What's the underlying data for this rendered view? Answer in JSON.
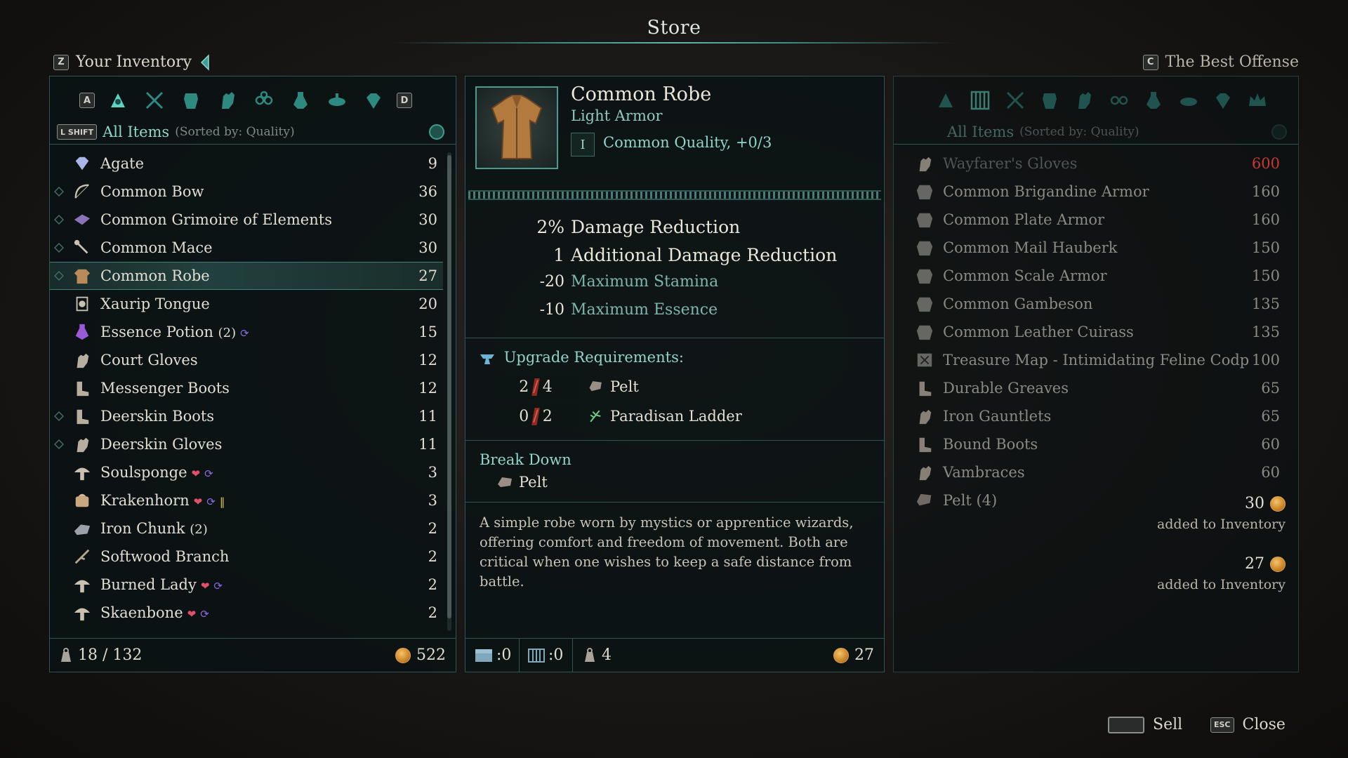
{
  "screen": {
    "title": "Store"
  },
  "left_header": {
    "key": "Z",
    "label": "Your Inventory"
  },
  "right_header": {
    "key": "C",
    "label": "The Best Offense"
  },
  "left_panel": {
    "tab_keys": {
      "prev": "A",
      "next": "D"
    },
    "tabs": [
      "all-items-icon",
      "weapons-icon",
      "armor-icon",
      "gloves-icon",
      "trinkets-icon",
      "potions-icon",
      "food-icon",
      "gems-icon"
    ],
    "filter_key": "L SHIFT",
    "filter_title": "All Items",
    "filter_sort": "(Sorted by: Quality)",
    "items": [
      {
        "name": "Agate",
        "value": "9",
        "icon": "gem-icon",
        "diamond": false
      },
      {
        "name": "Common Bow",
        "value": "36",
        "icon": "bow-icon",
        "diamond": true
      },
      {
        "name": "Common Grimoire of Elements",
        "value": "30",
        "icon": "grimoire-icon",
        "diamond": true
      },
      {
        "name": "Common Mace",
        "value": "30",
        "icon": "mace-icon",
        "diamond": true
      },
      {
        "name": "Common Robe",
        "value": "27",
        "icon": "robe-icon",
        "diamond": true,
        "selected": true
      },
      {
        "name": "Xaurip Tongue",
        "value": "20",
        "icon": "tongue-icon",
        "diamond": false
      },
      {
        "name": "Essence Potion",
        "count": "(2)",
        "value": "15",
        "icon": "potion-icon",
        "diamond": false,
        "badges": [
          "essence"
        ]
      },
      {
        "name": "Court Gloves",
        "value": "12",
        "icon": "gloves-icon",
        "diamond": false
      },
      {
        "name": "Messenger Boots",
        "value": "12",
        "icon": "boots-icon",
        "diamond": false
      },
      {
        "name": "Deerskin Boots",
        "value": "11",
        "icon": "boots-icon",
        "diamond": true
      },
      {
        "name": "Deerskin Gloves",
        "value": "11",
        "icon": "gloves-icon",
        "diamond": true
      },
      {
        "name": "Soulsponge",
        "value": "3",
        "icon": "mushroom-icon",
        "diamond": false,
        "badges": [
          "heart",
          "essence"
        ]
      },
      {
        "name": "Krakenhorn",
        "value": "3",
        "icon": "krakenhorn-icon",
        "diamond": false,
        "badges": [
          "heart",
          "essence",
          "stamina"
        ]
      },
      {
        "name": "Iron Chunk",
        "count": "(2)",
        "value": "2",
        "icon": "ore-icon",
        "diamond": false
      },
      {
        "name": "Softwood Branch",
        "value": "2",
        "icon": "branch-icon",
        "diamond": false
      },
      {
        "name": "Burned Lady",
        "value": "2",
        "icon": "mushroom-icon",
        "diamond": false,
        "badges": [
          "heart",
          "essence"
        ]
      },
      {
        "name": "Skaenbone",
        "value": "2",
        "icon": "mushroom-icon",
        "diamond": false,
        "badges": [
          "heart",
          "essence"
        ]
      }
    ],
    "footer": {
      "weight": "18 / 132",
      "gold": "522"
    }
  },
  "detail": {
    "name": "Common Robe",
    "type": "Light Armor",
    "quality_tier": "I",
    "quality": "Common Quality, +0/3",
    "stats": [
      {
        "num": "2%",
        "label": "Damage Reduction",
        "dim": false
      },
      {
        "num": "1",
        "label": "Additional Damage Reduction",
        "dim": false
      },
      {
        "num": "-20",
        "label": "Maximum Stamina",
        "dim": true
      },
      {
        "num": "-10",
        "label": "Maximum Essence",
        "dim": true
      }
    ],
    "upgrade_title": "Upgrade Requirements:",
    "requirements": [
      {
        "have": "2",
        "slash": "/",
        "need": "4",
        "name": "Pelt",
        "icon": "pelt-icon"
      },
      {
        "have": "0",
        "slash": "/",
        "need": "2",
        "name": "Paradisan Ladder",
        "icon": "herb-icon"
      }
    ],
    "breakdown_title": "Break Down",
    "breakdown_item": "Pelt",
    "description": "A simple robe worn by mystics or apprentice wizards, offering comfort and freedom of movement. Both are critical when one wishes to keep a safe distance from battle.",
    "footer": {
      "stash_a": ":0",
      "stash_b": ":0",
      "weight": "4",
      "price": "27"
    }
  },
  "right_panel": {
    "filter_title": "All Items",
    "filter_sort": "(Sorted by: Quality)",
    "items": [
      {
        "name": "Wayfarer's Gloves",
        "value": "600",
        "faded": true,
        "red": true,
        "icon": "gloves-icon"
      },
      {
        "name": "Common Brigandine Armor",
        "value": "160",
        "icon": "armor-icon"
      },
      {
        "name": "Common Plate Armor",
        "value": "160",
        "icon": "armor-icon"
      },
      {
        "name": "Common Mail Hauberk",
        "value": "150",
        "icon": "armor-icon"
      },
      {
        "name": "Common Scale Armor",
        "value": "150",
        "icon": "armor-icon"
      },
      {
        "name": "Common Gambeson",
        "value": "135",
        "icon": "armor-icon"
      },
      {
        "name": "Common Leather Cuirass",
        "value": "135",
        "icon": "armor-icon"
      },
      {
        "name": "Treasure Map - Intimidating Feline Codp",
        "value": "100",
        "icon": "map-icon"
      },
      {
        "name": "Durable Greaves",
        "value": "65",
        "icon": "boots-icon"
      },
      {
        "name": "Iron Gauntlets",
        "value": "65",
        "icon": "gloves-icon"
      },
      {
        "name": "Bound Boots",
        "value": "60",
        "icon": "boots-icon"
      },
      {
        "name": "Vambraces",
        "value": "60",
        "icon": "gloves-icon"
      },
      {
        "name": "Pelt (4)",
        "value": "",
        "icon": "pelt-icon"
      }
    ],
    "notifications": [
      {
        "amount": "30",
        "text": "added to Inventory"
      },
      {
        "amount": "27",
        "text": "added to Inventory"
      }
    ]
  },
  "actions": {
    "sell": "Sell",
    "close_key": "ESC",
    "close": "Close"
  },
  "colors": {
    "accent": "#5fb7b0",
    "gold": "#d49a3a",
    "red": "#c83a2c"
  }
}
